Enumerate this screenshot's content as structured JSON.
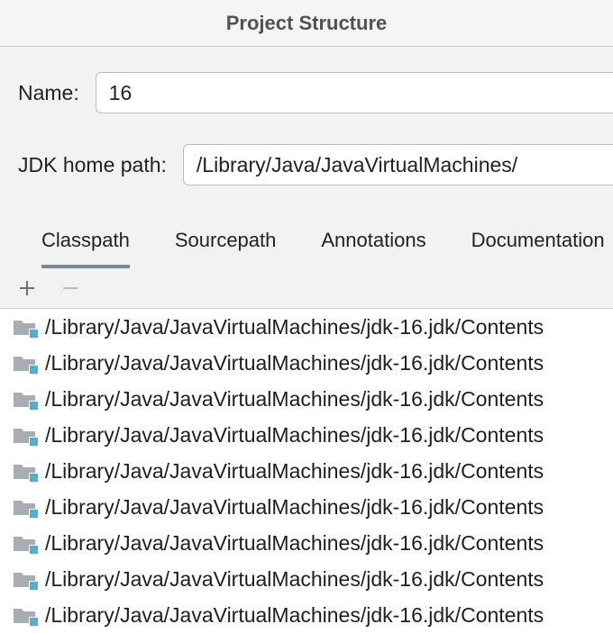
{
  "window": {
    "title": "Project Structure"
  },
  "form": {
    "name_label": "Name:",
    "name_value": "16",
    "jdk_label": "JDK home path:",
    "jdk_value": "/Library/Java/JavaVirtualMachines/"
  },
  "tabs": {
    "items": [
      {
        "label": "Classpath",
        "active": true
      },
      {
        "label": "Sourcepath",
        "active": false
      },
      {
        "label": "Annotations",
        "active": false
      },
      {
        "label": "Documentation",
        "active": false
      }
    ]
  },
  "toolbar": {
    "add_icon": "plus-icon",
    "remove_icon": "minus-icon"
  },
  "classpath": {
    "entries": [
      "/Library/Java/JavaVirtualMachines/jdk-16.jdk/Contents",
      "/Library/Java/JavaVirtualMachines/jdk-16.jdk/Contents",
      "/Library/Java/JavaVirtualMachines/jdk-16.jdk/Contents",
      "/Library/Java/JavaVirtualMachines/jdk-16.jdk/Contents",
      "/Library/Java/JavaVirtualMachines/jdk-16.jdk/Contents",
      "/Library/Java/JavaVirtualMachines/jdk-16.jdk/Contents",
      "/Library/Java/JavaVirtualMachines/jdk-16.jdk/Contents",
      "/Library/Java/JavaVirtualMachines/jdk-16.jdk/Contents",
      "/Library/Java/JavaVirtualMachines/jdk-16.jdk/Contents"
    ]
  }
}
